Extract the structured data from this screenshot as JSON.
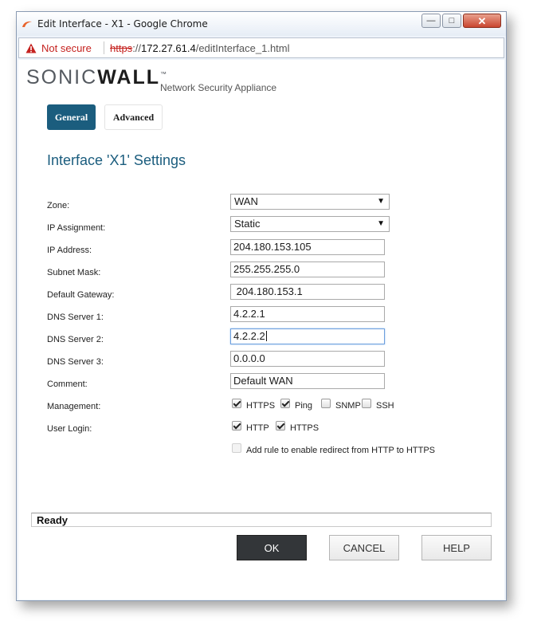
{
  "window": {
    "title": "Edit Interface - X1 - Google Chrome",
    "minimize_label": "—",
    "maximize_label": "□",
    "close_label": "✕"
  },
  "address_bar": {
    "security_label": "Not secure",
    "url_scheme": "https",
    "url_rest_prefix": "://",
    "url_host": "172.27.61.4",
    "url_path": "/editInterface_1.html"
  },
  "brand": {
    "logo_light": "SONIC",
    "logo_bold": "WALL",
    "tm": "™",
    "subtitle": "Network Security Appliance"
  },
  "tabs": [
    {
      "label": "General",
      "active": true
    },
    {
      "label": "Advanced",
      "active": false
    }
  ],
  "form": {
    "title": "Interface 'X1' Settings",
    "zone": {
      "label": "Zone:",
      "value": "WAN"
    },
    "ip_assignment": {
      "label": "IP Assignment:",
      "value": "Static"
    },
    "ip_address": {
      "label": "IP Address:",
      "value": "204.180.153.105"
    },
    "subnet_mask": {
      "label": "Subnet Mask:",
      "value": "255.255.255.0"
    },
    "default_gateway": {
      "label": "Default Gateway:",
      "value": " 204.180.153.1"
    },
    "dns1": {
      "label": "DNS Server 1:",
      "value": "4.2.2.1"
    },
    "dns2": {
      "label": "DNS Server 2:",
      "value": "4.2.2.2"
    },
    "dns3": {
      "label": "DNS Server 3:",
      "value": "0.0.0.0"
    },
    "comment": {
      "label": "Comment:",
      "value": "Default WAN"
    },
    "management": {
      "label": "Management:",
      "options": [
        {
          "label": "HTTPS",
          "checked": true
        },
        {
          "label": "Ping",
          "checked": true
        },
        {
          "label": "SNMP",
          "checked": false
        },
        {
          "label": "SSH",
          "checked": false
        }
      ]
    },
    "user_login": {
      "label": "User Login:",
      "options": [
        {
          "label": "HTTP",
          "checked": true
        },
        {
          "label": "HTTPS",
          "checked": true
        }
      ]
    },
    "redirect_rule": {
      "label": "Add rule to enable redirect from HTTP to HTTPS",
      "checked": false,
      "disabled": true
    }
  },
  "status": "Ready",
  "buttons": {
    "ok": "OK",
    "cancel": "CANCEL",
    "help": "HELP"
  },
  "colors": {
    "accent": "#1b5d7e",
    "ok_button": "#333639",
    "insecure_red": "#c5221f"
  }
}
